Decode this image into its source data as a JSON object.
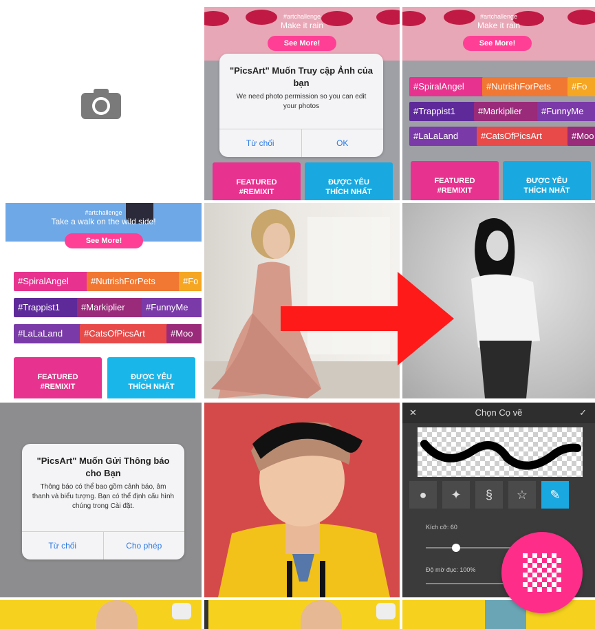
{
  "grid": {
    "camera_icon": "camera-icon",
    "permission_photos": {
      "banner_line1": "#artchallenge",
      "banner_line2": "Make it rain",
      "see_more": "See More!",
      "dialog_title": "\"PicsArt\" Muốn Truy cập Ảnh của bạn",
      "dialog_message": "We need photo permission so you can edit your photos",
      "deny_button": "Từ chối",
      "ok_button": "OK",
      "tile_featured_line1": "FEATURED",
      "tile_featured_line2": "#REMIXIT",
      "tile_popular_line1": "ĐƯỢC YÊU",
      "tile_popular_line2": "THÍCH NHẤT"
    },
    "feed_screen": {
      "banner_line1": "#artchallenge",
      "banner_line2": "Make it rain",
      "see_more": "See More!",
      "tags_row1": [
        "#SpiralAngel",
        "#NutrishForPets",
        "#Fo"
      ],
      "tags_row2": [
        "#Trappist1",
        "#Markiplier",
        "#FunnyMe"
      ],
      "tags_row3": [
        "#LaLaLand",
        "#CatsOfPicsArt",
        "#Moo"
      ],
      "tile_featured_line1": "FEATURED",
      "tile_featured_line2": "#REMIXIT",
      "tile_popular_line1": "ĐƯỢC YÊU",
      "tile_popular_line2": "THÍCH NHẤT"
    },
    "feed_screen_2": {
      "banner_line1": "#artchallenge",
      "banner_line2": "Take a walk on the wild side!",
      "see_more": "See More!",
      "tags_row1": [
        "#SpiralAngel",
        "#NutrishForPets",
        "#Fo"
      ],
      "tags_row2": [
        "#Trappist1",
        "#Markiplier",
        "#FunnyMe"
      ],
      "tags_row3": [
        "#LaLaLand",
        "#CatsOfPicsArt",
        "#Moo"
      ],
      "tile_featured_line1": "FEATURED",
      "tile_featured_line2": "#REMIXIT",
      "tile_popular_line1": "ĐƯỢC YÊU",
      "tile_popular_line2": "THÍCH NHẤT"
    },
    "permission_notifications": {
      "dialog_title": "\"PicsArt\" Muốn Gửi Thông báo cho Bạn",
      "dialog_message": "Thông báo có thể bao gồm cảnh báo, âm thanh và biểu tượng. Bạn có thể định cấu hình chúng trong Cài đặt.",
      "deny_button": "Từ chối",
      "allow_button": "Cho phép"
    },
    "brush_picker": {
      "title": "Chọn Cọ vẽ",
      "size_label": "Kích cỡ: 60",
      "opacity_label": "Độ mờ đục: 100%"
    }
  },
  "colors": {
    "accent_pink": "#ff2d8a",
    "arrow_red": "#ff1a1a",
    "dialog_blue": "#2d7be4"
  },
  "fab": {
    "icon": "checkerboard-icon"
  }
}
